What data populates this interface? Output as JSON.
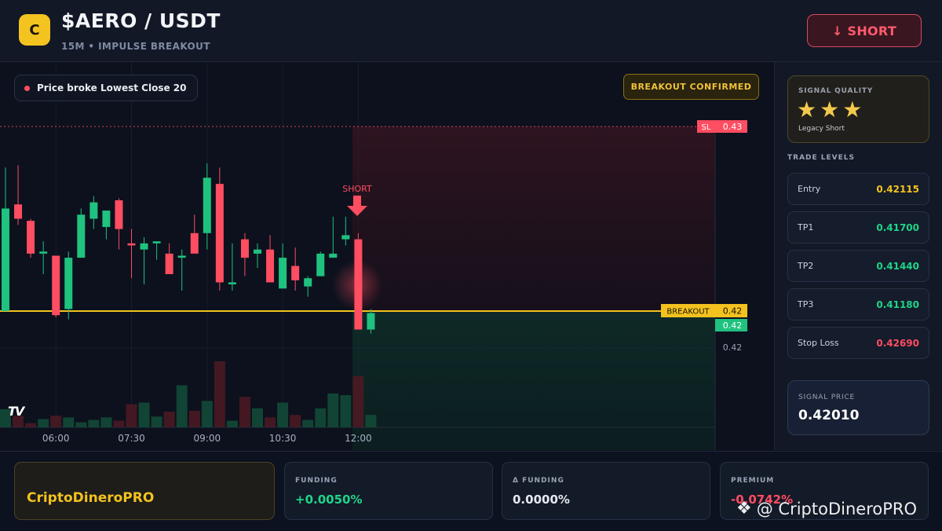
{
  "header": {
    "logo_letter": "C",
    "title": "$AERO / USDT",
    "subtitle": "15M • IMPULSE BREAKOUT",
    "short_button": "↓ SHORT"
  },
  "chart": {
    "status_pill": "Price broke Lowest Close 20",
    "breakout_badge": "BREAKOUT CONFIRMED",
    "short_marker": "SHORT",
    "sl_tag": "SL",
    "sl_value": "0.43",
    "breakout_tag": "BREAKOUT",
    "breakout_value": "0.42",
    "current_value": "0.42",
    "axis_value": "0.42",
    "time_labels": [
      "06:00",
      "07:30",
      "09:00",
      "10:30",
      "12:00"
    ],
    "tv_logo": "TV",
    "colors": {
      "up": "#1fc27f",
      "down": "#ff4d61",
      "breakout": "#f3c21e"
    }
  },
  "chart_data": {
    "type": "candlestick",
    "x": [
      "05:00",
      "05:15",
      "05:30",
      "05:45",
      "06:00",
      "06:15",
      "06:30",
      "06:45",
      "07:00",
      "07:15",
      "07:30",
      "07:45",
      "08:00",
      "08:15",
      "08:30",
      "08:45",
      "09:00",
      "09:15",
      "09:30",
      "09:45",
      "10:00",
      "10:15",
      "10:30",
      "10:45",
      "11:00",
      "11:15",
      "11:30",
      "11:45",
      "12:00",
      "12:15"
    ],
    "candles": [
      {
        "o": 0.421,
        "h": 0.428,
        "l": 0.421,
        "c": 0.426,
        "v": 22
      },
      {
        "o": 0.4262,
        "h": 0.4281,
        "l": 0.4252,
        "c": 0.4255,
        "v": 14
      },
      {
        "o": 0.4254,
        "h": 0.4255,
        "l": 0.4236,
        "c": 0.4238,
        "v": 5
      },
      {
        "o": 0.4238,
        "h": 0.4244,
        "l": 0.4228,
        "c": 0.4239,
        "v": 10
      },
      {
        "o": 0.4237,
        "h": 0.4237,
        "l": 0.4207,
        "c": 0.4208,
        "v": 14
      },
      {
        "o": 0.4211,
        "h": 0.4239,
        "l": 0.4206,
        "c": 0.4236,
        "v": 12
      },
      {
        "o": 0.4236,
        "h": 0.426,
        "l": 0.4236,
        "c": 0.4257,
        "v": 6
      },
      {
        "o": 0.4255,
        "h": 0.4266,
        "l": 0.425,
        "c": 0.4263,
        "v": 9
      },
      {
        "o": 0.4251,
        "h": 0.4259,
        "l": 0.4245,
        "c": 0.4259,
        "v": 12
      },
      {
        "o": 0.4264,
        "h": 0.4265,
        "l": 0.424,
        "c": 0.425,
        "v": 8
      },
      {
        "o": 0.4243,
        "h": 0.425,
        "l": 0.4226,
        "c": 0.4242,
        "v": 28
      },
      {
        "o": 0.424,
        "h": 0.4246,
        "l": 0.4223,
        "c": 0.4243,
        "v": 30
      },
      {
        "o": 0.4243,
        "h": 0.4244,
        "l": 0.4235,
        "c": 0.4244,
        "v": 13
      },
      {
        "o": 0.4238,
        "h": 0.4243,
        "l": 0.4228,
        "c": 0.4228,
        "v": 19
      },
      {
        "o": 0.4236,
        "h": 0.424,
        "l": 0.422,
        "c": 0.4237,
        "v": 51
      },
      {
        "o": 0.4248,
        "h": 0.4257,
        "l": 0.4246,
        "c": 0.4238,
        "v": 20
      },
      {
        "o": 0.4248,
        "h": 0.4282,
        "l": 0.424,
        "c": 0.4275,
        "v": 32
      },
      {
        "o": 0.4272,
        "h": 0.428,
        "l": 0.422,
        "c": 0.4224,
        "v": 80
      },
      {
        "o": 0.4223,
        "h": 0.4243,
        "l": 0.422,
        "c": 0.4224,
        "v": 8
      },
      {
        "o": 0.4245,
        "h": 0.4248,
        "l": 0.4227,
        "c": 0.4236,
        "v": 37
      },
      {
        "o": 0.4238,
        "h": 0.4243,
        "l": 0.4231,
        "c": 0.424,
        "v": 23
      },
      {
        "o": 0.424,
        "h": 0.4247,
        "l": 0.4228,
        "c": 0.4224,
        "v": 12
      },
      {
        "o": 0.4221,
        "h": 0.4243,
        "l": 0.4221,
        "c": 0.4236,
        "v": 30
      },
      {
        "o": 0.4232,
        "h": 0.4241,
        "l": 0.422,
        "c": 0.4225,
        "v": 15
      },
      {
        "o": 0.4222,
        "h": 0.4227,
        "l": 0.4217,
        "c": 0.4226,
        "v": 9
      },
      {
        "o": 0.4227,
        "h": 0.4239,
        "l": 0.4227,
        "c": 0.4238,
        "v": 23
      },
      {
        "o": 0.4236,
        "h": 0.4256,
        "l": 0.4236,
        "c": 0.4238,
        "v": 41
      },
      {
        "o": 0.4245,
        "h": 0.4256,
        "l": 0.4242,
        "c": 0.4247,
        "v": 39
      },
      {
        "o": 0.4245,
        "h": 0.4248,
        "l": 0.4201,
        "c": 0.4201,
        "v": 62
      },
      {
        "o": 0.4201,
        "h": 0.4211,
        "l": 0.4199,
        "c": 0.4209,
        "v": 15
      }
    ],
    "sl_level": 0.43,
    "breakout_level": 0.421,
    "ylim": [
      0.419,
      0.432
    ],
    "xlabel": "",
    "ylabel": ""
  },
  "sidebar": {
    "quality_label": "SIGNAL QUALITY",
    "stars": "★★★",
    "stars_value": 3,
    "quality_sub": "Legacy Short",
    "levels_title": "TRADE LEVELS",
    "levels": [
      {
        "name": "Entry",
        "value": "0.42115",
        "color": "#f3c21e"
      },
      {
        "name": "TP1",
        "value": "0.41700",
        "color": "#1fd488"
      },
      {
        "name": "TP2",
        "value": "0.41440",
        "color": "#1fd488"
      },
      {
        "name": "TP3",
        "value": "0.41180",
        "color": "#1fd488"
      },
      {
        "name": "Stop Loss",
        "value": "0.42690",
        "color": "#ff4d61"
      }
    ],
    "signal_price_label": "SIGNAL PRICE",
    "signal_price": "0.42010"
  },
  "footer": {
    "brand": "CriptoDineroPRO",
    "funding_label": "FUNDING",
    "funding_value": "+0.0050%",
    "dfunding_label": "Δ FUNDING",
    "dfunding_value": "0.0000%",
    "premium_label": "PREMIUM",
    "premium_value": "-0.0742%",
    "watermark": "@ CriptoDineroPRO"
  }
}
